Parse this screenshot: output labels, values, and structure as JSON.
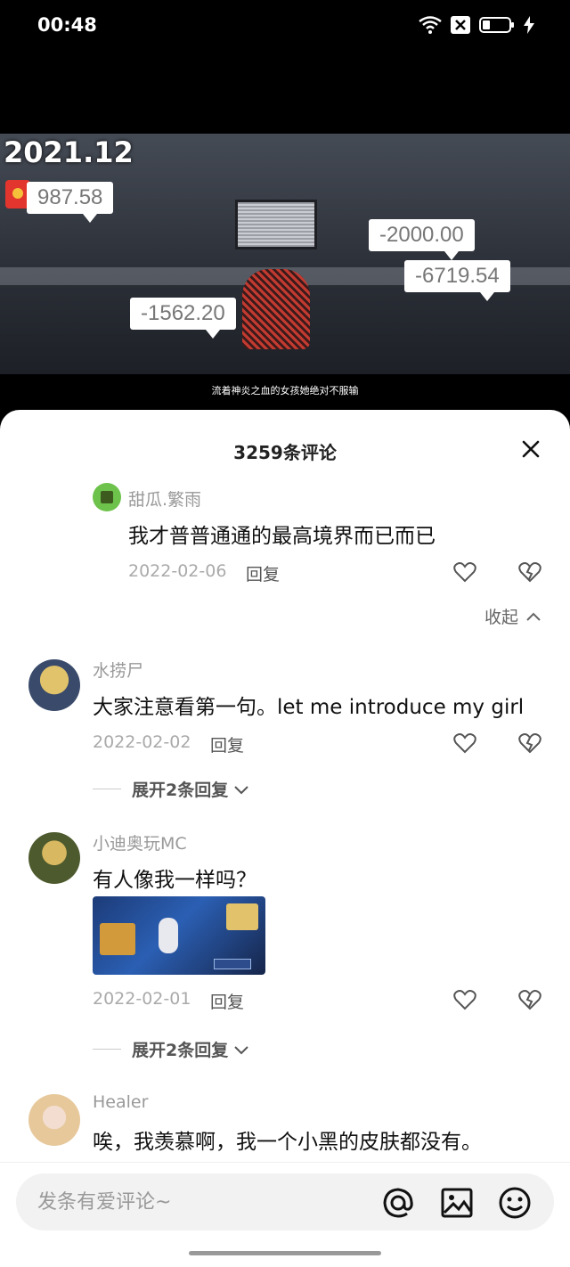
{
  "status_bar": {
    "time": "00:48"
  },
  "video": {
    "year_label": "2021.12",
    "bubbles": [
      "987.58",
      "-2000.00",
      "-6719.54",
      "-1562.20"
    ],
    "subtitle": "流着神炎之血的女孩她绝对不服输"
  },
  "comments_panel": {
    "title": "3259条评论",
    "collapse_label": "收起",
    "comments": [
      {
        "name": "甜瓜.繁雨",
        "text": "我才普普通通的最高境界而已而已",
        "date": "2022-02-06",
        "reply": "回复"
      },
      {
        "name": "水捞尸",
        "text": "大家注意看第一句。let me introduce my girl",
        "date": "2022-02-02",
        "reply": "回复",
        "expand": "展开2条回复"
      },
      {
        "name": "小迪奥玩MC",
        "text": "有人像我一样吗？",
        "date": "2022-02-01",
        "reply": "回复",
        "expand": "展开2条回复"
      },
      {
        "name": "Healer",
        "text": "唉，我羡慕啊，我一个小黑的皮肤都没有。"
      }
    ]
  },
  "input_bar": {
    "placeholder": "发条有爱评论~"
  },
  "icons": {
    "close": "close-icon",
    "like": "heart-icon",
    "dislike": "broken-heart-icon",
    "mention": "at-icon",
    "image": "image-icon",
    "emoji": "emoji-icon"
  }
}
